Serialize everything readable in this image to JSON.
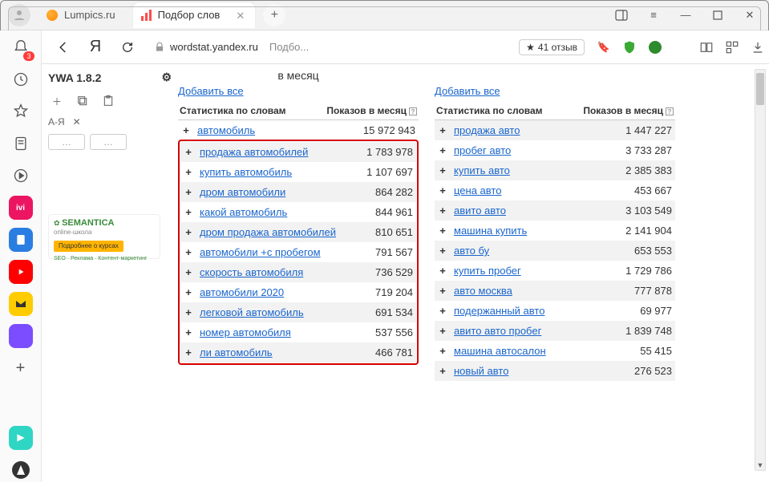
{
  "tabs": {
    "t1_label": "Lumpics.ru",
    "t2_label": "Подбор слов"
  },
  "addr": {
    "host": "wordstat.yandex.ru",
    "title_trim": "Подбо...",
    "reviews": "41 отзыв"
  },
  "ywa": {
    "title": "YWA 1.8.2",
    "sort": "А-Я"
  },
  "ad": {
    "logo": "SEMANTICA",
    "sub": "online-школа",
    "btn": "Подробнее о курсах",
    "tags": "SEO · Реклама · Контент-маркетинг"
  },
  "hdr": {
    "month": "в месяц",
    "addall": "Добавить все",
    "c1": "Статистика по словам",
    "c2": "Показов в месяц"
  },
  "plus": "+",
  "left_first": {
    "kw": "автомобиль",
    "n": "15 972 943"
  },
  "left": [
    {
      "kw": "продажа автомобилей",
      "n": "1 783 978"
    },
    {
      "kw": "купить автомобиль",
      "n": "1 107 697"
    },
    {
      "kw": "дром автомобили",
      "n": "864 282"
    },
    {
      "kw": "какой автомобиль",
      "n": "844 961"
    },
    {
      "kw": "дром продажа автомобилей",
      "n": "810 651"
    },
    {
      "kw": "автомобили +с пробегом",
      "n": "791 567"
    },
    {
      "kw": "скорость автомобиля",
      "n": "736 529"
    },
    {
      "kw": "автомобили 2020",
      "n": "719 204"
    },
    {
      "kw": "легковой автомобиль",
      "n": "691 534"
    },
    {
      "kw": "номер автомобиля",
      "n": "537 556"
    },
    {
      "kw": "ли автомобиль",
      "n": "466 781"
    }
  ],
  "right": [
    {
      "kw": "продажа авто",
      "n": "1 447 227"
    },
    {
      "kw": "пробег авто",
      "n": "3 733 287"
    },
    {
      "kw": "купить авто",
      "n": "2 385 383"
    },
    {
      "kw": "цена авто",
      "n": "453 667"
    },
    {
      "kw": "авито авто",
      "n": "3 103 549"
    },
    {
      "kw": "машина купить",
      "n": "2 141 904"
    },
    {
      "kw": "авто бу",
      "n": "653 553"
    },
    {
      "kw": "купить пробег",
      "n": "1 729 786"
    },
    {
      "kw": "авто москва",
      "n": "777 878"
    },
    {
      "kw": "подержанный авто",
      "n": "69 977"
    },
    {
      "kw": "авито авто пробег",
      "n": "1 839 748"
    },
    {
      "kw": "машина автосалон",
      "n": "55 415"
    },
    {
      "kw": "новый авто",
      "n": "276 523"
    }
  ]
}
